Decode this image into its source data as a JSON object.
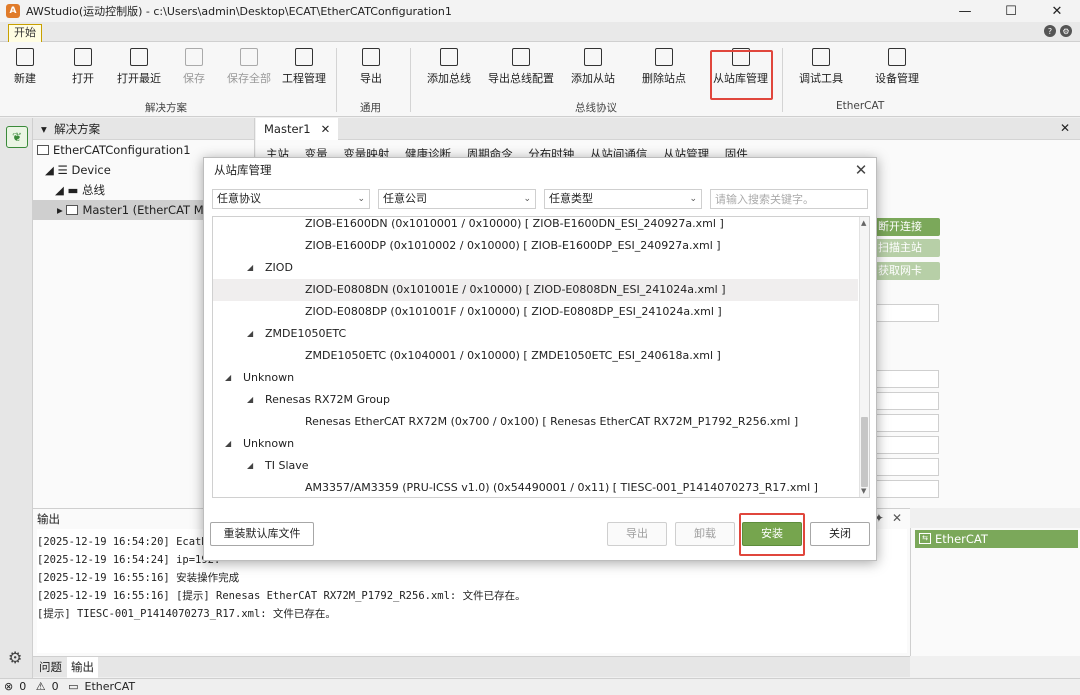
{
  "window": {
    "app_icon": "app-logo-icon",
    "title": "AWStudio(运动控制版) - c:\\Users\\admin\\Desktop\\ECAT\\EtherCATConfiguration1",
    "minimize": "—",
    "maximize": "☐",
    "close": "✕"
  },
  "ribbon": {
    "tab": "开始",
    "help_icons": [
      "?",
      "⚙"
    ],
    "buttons": [
      {
        "label": "新建",
        "icon": "new-icon",
        "enabled": true
      },
      {
        "label": "打开",
        "icon": "open-icon",
        "enabled": true
      },
      {
        "label": "打开最近",
        "icon": "open-recent-icon",
        "enabled": true
      },
      {
        "label": "保存",
        "icon": "save-icon",
        "enabled": false
      },
      {
        "label": "保存全部",
        "icon": "save-all-icon",
        "enabled": false
      },
      {
        "label": "工程管理",
        "icon": "project-manage-icon",
        "enabled": true
      },
      {
        "label": "导出",
        "icon": "export-icon",
        "enabled": true
      },
      {
        "label": "添加总线",
        "icon": "add-bus-icon",
        "enabled": true
      },
      {
        "label": "导出总线配置",
        "icon": "export-bus-config-icon",
        "enabled": true
      },
      {
        "label": "添加从站",
        "icon": "add-slave-icon",
        "enabled": true
      },
      {
        "label": "删除站点",
        "icon": "delete-station-icon",
        "enabled": true
      },
      {
        "label": "从站库管理",
        "icon": "slave-library-icon",
        "enabled": true
      },
      {
        "label": "调试工具",
        "icon": "debug-tool-icon",
        "enabled": true
      },
      {
        "label": "设备管理",
        "icon": "device-manage-icon",
        "enabled": true
      }
    ],
    "groups": [
      "解决方案",
      "通用",
      "总线协议",
      "EtherCAT"
    ]
  },
  "solution_panel": {
    "title": "解决方案",
    "tree": [
      {
        "label": "EtherCATConfiguration1",
        "level": 0
      },
      {
        "label": "Device",
        "level": 1
      },
      {
        "label": "总线",
        "level": 2
      },
      {
        "label": "Master1 (EtherCAT Mas",
        "level": 3
      }
    ]
  },
  "document": {
    "tab": "Master1",
    "subtabs": [
      "主站",
      "变量",
      "变量映射",
      "健康诊断",
      "周期命令",
      "分布时钟",
      "从站间通信",
      "从站管理",
      "固件"
    ],
    "side_buttons": [
      "断开连接",
      "扫描主站",
      "获取网卡"
    ]
  },
  "output": {
    "title": "输出",
    "lines": [
      "[2025-12-19 16:54:20] EcatRP",
      "[2025-12-19 16:54:24] ip=192.",
      "[2025-12-19 16:55:16] 安装操作完成",
      "[2025-12-19 16:55:16] [提示] Renesas EtherCAT RX72M_P1792_R256.xml: 文件已存在。",
      "[提示] TIESC-001_P1414070273_R17.xml: 文件已存在。"
    ],
    "bottom_tabs": [
      "问题",
      "输出"
    ],
    "right_item": "EtherCAT"
  },
  "statusbar": {
    "errors": "0",
    "warnings": "0",
    "mode": "EtherCAT"
  },
  "dialog": {
    "title": "从站库管理",
    "filters": {
      "protocol": "任意协议",
      "company": "任意公司",
      "type": "任意类型"
    },
    "search_placeholder": "请输入搜索关键字。",
    "rows": [
      {
        "text": "ZIOB-E1600DN (0x1010001 / 0x10000) [ ZIOB-E1600DN_ESI_240927a.xml ]",
        "indent": 3,
        "toggle": false,
        "selected": false
      },
      {
        "text": "ZIOB-E1600DP (0x1010002 / 0x10000) [ ZIOB-E1600DP_ESI_240927a.xml ]",
        "indent": 3,
        "toggle": false,
        "selected": false
      },
      {
        "text": "ZIOD",
        "indent": 2,
        "toggle": true,
        "selected": false
      },
      {
        "text": "ZIOD-E0808DN (0x101001E / 0x10000) [ ZIOD-E0808DN_ESI_241024a.xml ]",
        "indent": 3,
        "toggle": false,
        "selected": true
      },
      {
        "text": "ZIOD-E0808DP (0x101001F / 0x10000) [ ZIOD-E0808DP_ESI_241024a.xml ]",
        "indent": 3,
        "toggle": false,
        "selected": false
      },
      {
        "text": "ZMDE1050ETC",
        "indent": 2,
        "toggle": true,
        "selected": false
      },
      {
        "text": "ZMDE1050ETC (0x1040001 / 0x10000) [ ZMDE1050ETC_ESI_240618a.xml ]",
        "indent": 3,
        "toggle": false,
        "selected": false
      },
      {
        "text": "Unknown",
        "indent": 1,
        "toggle": true,
        "selected": false
      },
      {
        "text": "Renesas RX72M Group",
        "indent": 2,
        "toggle": true,
        "selected": false
      },
      {
        "text": "Renesas EtherCAT RX72M (0x700 / 0x100) [ Renesas EtherCAT RX72M_P1792_R256.xml ]",
        "indent": 3,
        "toggle": false,
        "selected": false
      },
      {
        "text": "Unknown",
        "indent": 1,
        "toggle": true,
        "selected": false
      },
      {
        "text": "TI Slave",
        "indent": 2,
        "toggle": true,
        "selected": false
      },
      {
        "text": "AM3357/AM3359 (PRU-ICSS v1.0) (0x54490001 / 0x11) [ TIESC-001_P1414070273_R17.xml ]",
        "indent": 3,
        "toggle": false,
        "selected": false
      }
    ],
    "buttons": {
      "reload": "重装默认库文件",
      "export": "导出",
      "uninstall": "卸载",
      "install": "安装",
      "close": "关闭"
    }
  },
  "colors": {
    "accent_green": "#76a54e",
    "highlight_red": "#e0463c",
    "app_orange": "#e07b2a"
  }
}
